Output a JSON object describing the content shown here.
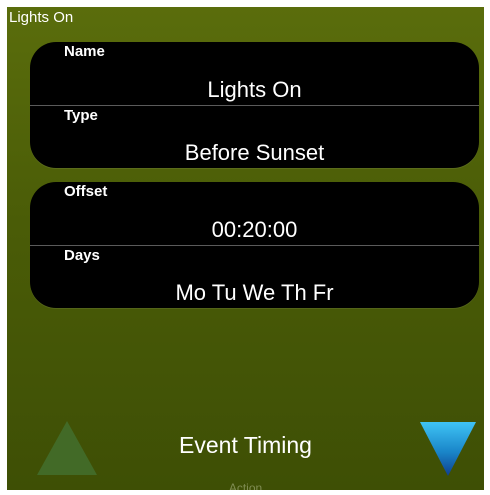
{
  "window": {
    "title": "Lights On"
  },
  "event": {
    "name_label": "Name",
    "name_value": "Lights On",
    "type_label": "Type",
    "type_value": "Before Sunset",
    "offset_label": "Offset",
    "offset_value": "00:20:00",
    "days_label": "Days",
    "days_value": "Mo Tu We Th Fr"
  },
  "footer": {
    "title": "Event Timing",
    "subtitle": "Action",
    "up_icon": "triangle-up-icon",
    "down_icon": "triangle-down-icon"
  },
  "colors": {
    "background": "#4a5c07",
    "panel": "#000000",
    "up_arrow": "#426a27",
    "down_arrow_top": "#3fc3f5",
    "down_arrow_bottom": "#0f3f8f"
  }
}
